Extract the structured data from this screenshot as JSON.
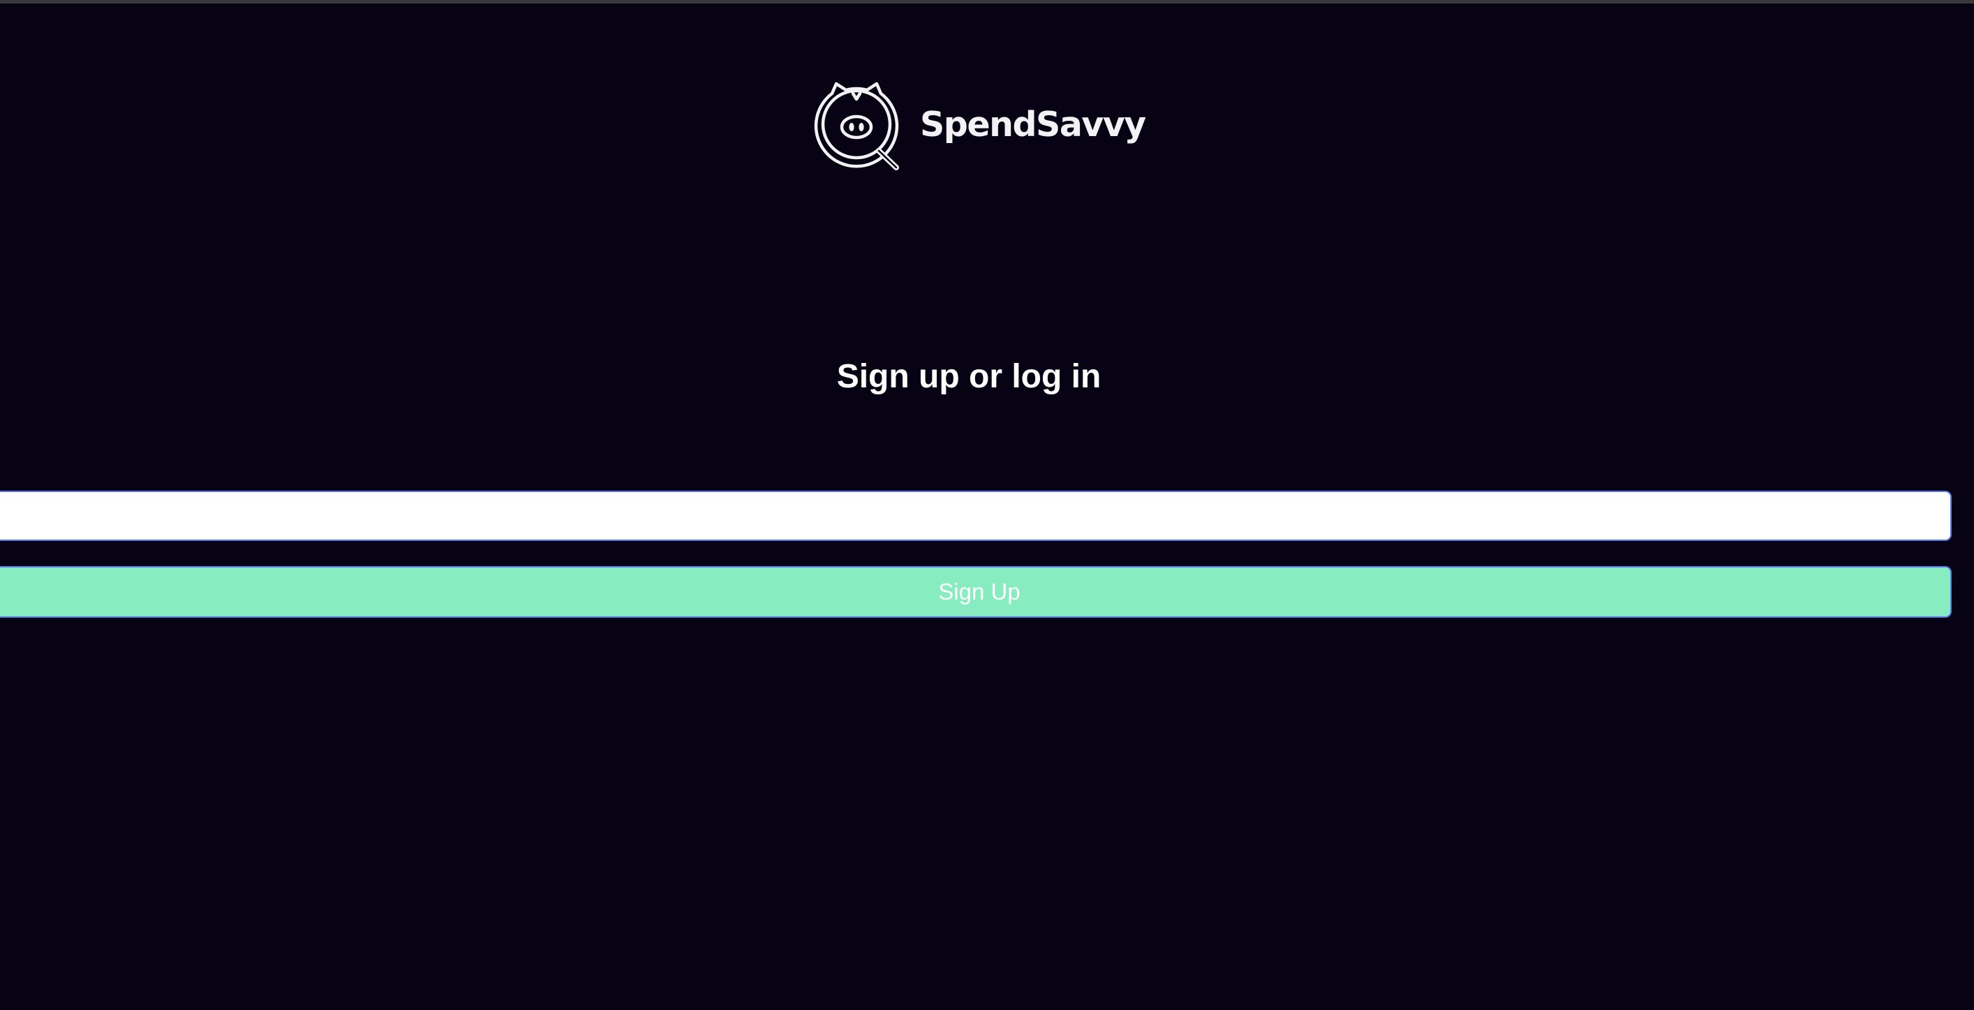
{
  "brand": {
    "name": "SpendSavvy",
    "logo_icon": "piggy-magnifier-icon"
  },
  "auth": {
    "heading": "Sign up or log in",
    "email_value": "",
    "email_placeholder": "",
    "submit_label": "Sign Up"
  },
  "colors": {
    "background": "#070314",
    "button_fill": "#87ecbf",
    "focus_border": "#5a78f0",
    "text": "#ffffff"
  }
}
